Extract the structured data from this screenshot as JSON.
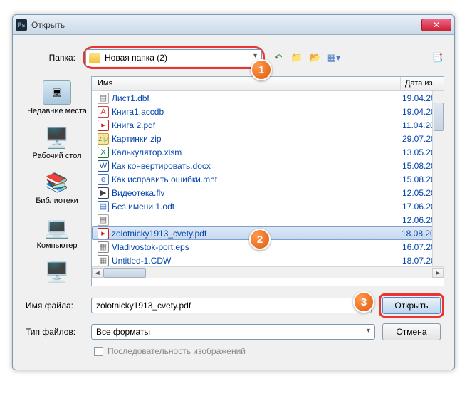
{
  "window": {
    "title": "Открыть"
  },
  "folder": {
    "label": "Папка:",
    "value": "Новая папка (2)"
  },
  "toolbar_icons": {
    "back": "arrow-back",
    "up": "folder-up",
    "new": "folder-new",
    "views": "views",
    "settings": "settings"
  },
  "places": {
    "recent": "Недавние места",
    "desktop": "Рабочий стол",
    "libraries": "Библиотеки",
    "computer": "Компьютер",
    "network": ""
  },
  "list": {
    "col_name": "Имя",
    "col_date": "Дата из",
    "items": [
      {
        "name": "Лист1.dbf",
        "date": "19.04.20",
        "type": "dbf"
      },
      {
        "name": "Книга1.accdb",
        "date": "19.04.20",
        "type": "accdb"
      },
      {
        "name": "Книга 2.pdf",
        "date": "11.04.20",
        "type": "pdf"
      },
      {
        "name": "Картинки.zip",
        "date": "29.07.20",
        "type": "zip"
      },
      {
        "name": "Калькулятор.xlsm",
        "date": "13.05.20",
        "type": "xlsm"
      },
      {
        "name": "Как конвертировать.docx",
        "date": "15.08.20",
        "type": "docx"
      },
      {
        "name": "Как исправить ошибки.mht",
        "date": "15.08.20",
        "type": "mht"
      },
      {
        "name": "Видеотека.flv",
        "date": "12.05.20",
        "type": "flv"
      },
      {
        "name": "Без имени 1.odt",
        "date": "17.06.20",
        "type": "odt"
      },
      {
        "name": "",
        "date": "12.06.20",
        "type": "dbf"
      },
      {
        "name": "zolotnicky1913_cvety.pdf",
        "date": "18.08.20",
        "type": "pdf",
        "selected": true
      },
      {
        "name": "Vladivostok-port.eps",
        "date": "16.07.20",
        "type": "eps"
      },
      {
        "name": "Untitled-1.CDW",
        "date": "18.07.20",
        "type": "cdw"
      }
    ]
  },
  "bottom": {
    "filename_label": "Имя файла:",
    "filename_value": "zolotnicky1913_cvety.pdf",
    "filetype_label": "Тип файлов:",
    "filetype_value": "Все форматы",
    "open": "Открыть",
    "cancel": "Отмена",
    "sequence": "Последовательность изображений"
  },
  "bubbles": {
    "b1": "1",
    "b2": "2",
    "b3": "3"
  }
}
